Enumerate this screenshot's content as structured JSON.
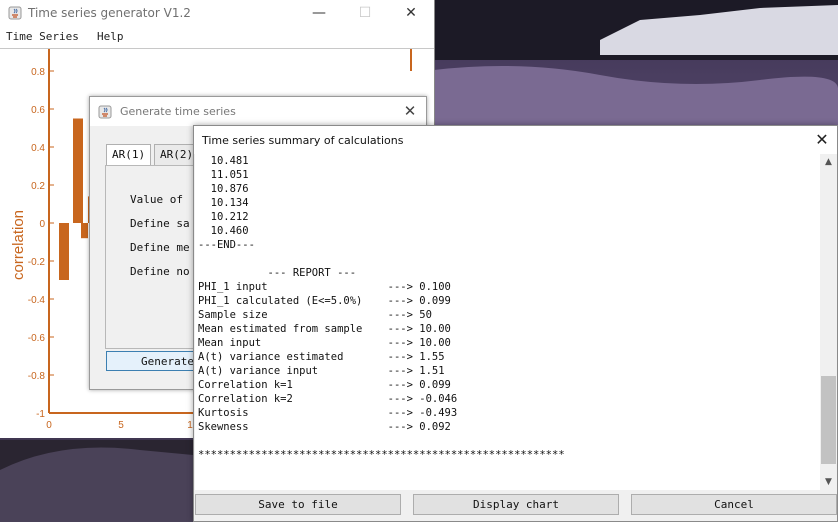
{
  "main_window": {
    "title": "Time series generator V1.2",
    "menu": [
      "Time Series",
      "Help"
    ],
    "caption_buttons": {
      "minimize": "—",
      "maximize": "☐",
      "close": "✕"
    }
  },
  "chart": {
    "ylabel": "correlation",
    "yticks": [
      "0.8",
      "0.6",
      "0.4",
      "0.2",
      "0",
      "-0.2",
      "-0.4",
      "-0.6",
      "-0.8",
      "-1"
    ],
    "xticks": [
      "0",
      "5",
      "1"
    ],
    "bar_color": "#c8661e"
  },
  "chart_data": {
    "type": "bar",
    "ylabel": "correlation",
    "ylim": [
      -1,
      0.9
    ],
    "categories": [
      "1",
      "2",
      "3",
      "4"
    ],
    "values": [
      -0.3,
      0.55,
      -0.08,
      0.14
    ]
  },
  "generate_dialog": {
    "title": "Generate time series",
    "tabs": [
      {
        "label": "AR(1)"
      },
      {
        "label": "AR(2)"
      }
    ],
    "labels": [
      "Value of",
      "Define sa",
      "Define me",
      "Define no"
    ],
    "generate_button": "Generate"
  },
  "summary_dialog": {
    "title": "Time series summary of calculations",
    "lines": [
      "  10.481",
      "  11.051",
      "  10.876",
      "  10.134",
      "  10.212",
      "  10.460",
      "---END---",
      "",
      "           --- REPORT ---",
      "PHI_1 input                   ---> 0.100",
      "PHI_1 calculated (E<=5.0%)    ---> 0.099",
      "Sample size                   ---> 50",
      "Mean estimated from sample    ---> 10.00",
      "Mean input                    ---> 10.00",
      "A(t) variance estimated       ---> 1.55",
      "A(t) variance input           ---> 1.51",
      "Correlation k=1               ---> 0.099",
      "Correlation k=2               ---> -0.046",
      "Kurtosis                      ---> -0.493",
      "Skewness                      ---> 0.092",
      "",
      "**********************************************************"
    ],
    "buttons": {
      "save": "Save to file",
      "display": "Display chart",
      "cancel": "Cancel"
    }
  }
}
